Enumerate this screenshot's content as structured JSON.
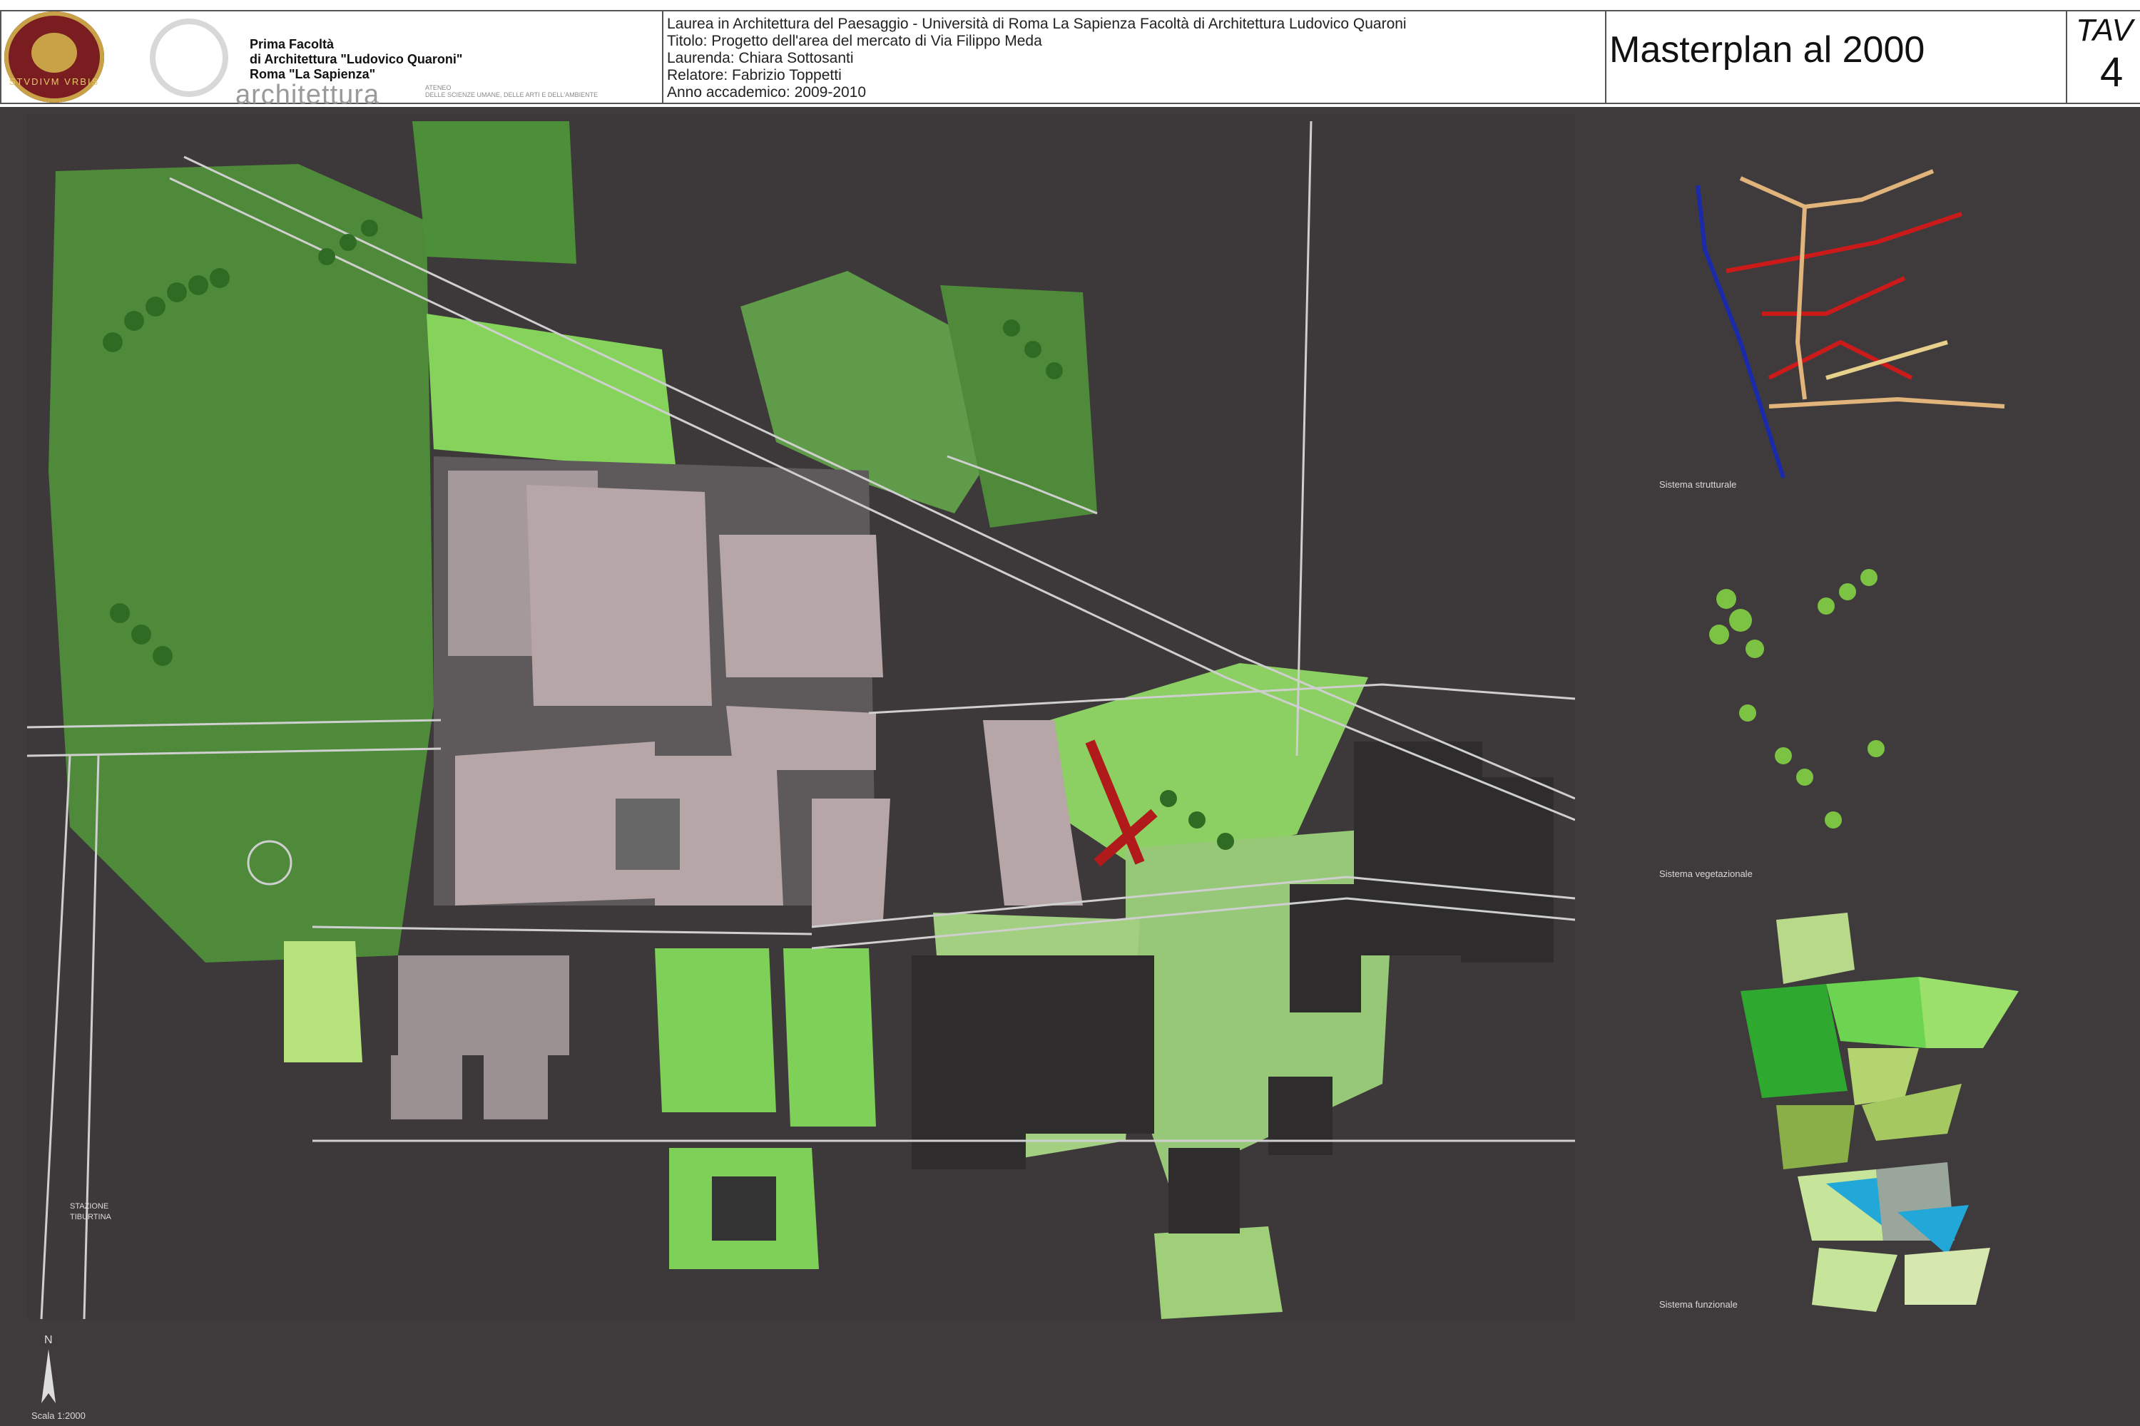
{
  "header": {
    "faculty_lines": [
      "Prima Facoltà",
      "di Architettura \"Ludovico Quaroni\"",
      "Roma \"La Sapienza\""
    ],
    "seal_text": "STVDIVM VRBIS",
    "architettura_word": "architettura",
    "ateneo_text": [
      "ATENEO",
      "DELLE SCIENZE UMANE, DELLE ARTI E DELL'AMBIENTE"
    ],
    "thesis_lines": [
      "Laurea in Architettura del Paesaggio - Università di Roma La Sapienza Facoltà di Architettura Ludovico Quaroni",
      "Titolo: Progetto dell'area del mercato di Via Filippo Meda",
      "Laurenda: Chiara Sottosanti",
      "Relatore: Fabrizio Toppetti",
      "Anno accademico: 2009-2010"
    ],
    "title": "Masterplan al 2000",
    "tav_label": "TAV",
    "tav_number": "4"
  },
  "map": {
    "station_label": [
      "STAZIONE",
      "TIBURTINA"
    ]
  },
  "diagrams": {
    "structural_caption": "Sistema strutturale",
    "vegetation_caption": "Sistema vegetazionale",
    "functional_caption": "Sistema funzionale"
  },
  "footer": {
    "north_label": "N",
    "scale_label": "Scala 1:2000"
  },
  "colors": {
    "background": "#3f3b3d",
    "lawn": "#4f8a3a",
    "bright_green": "#7fcf4f",
    "building_pink": "#b7a6a8",
    "road_line": "#cfcfcf",
    "dark_building": "#5a5758",
    "structural_blue": "#1a2aa8",
    "structural_red": "#cc1a1a",
    "structural_tan": "#e0b47a",
    "functional_cyan": "#22a8d8"
  }
}
